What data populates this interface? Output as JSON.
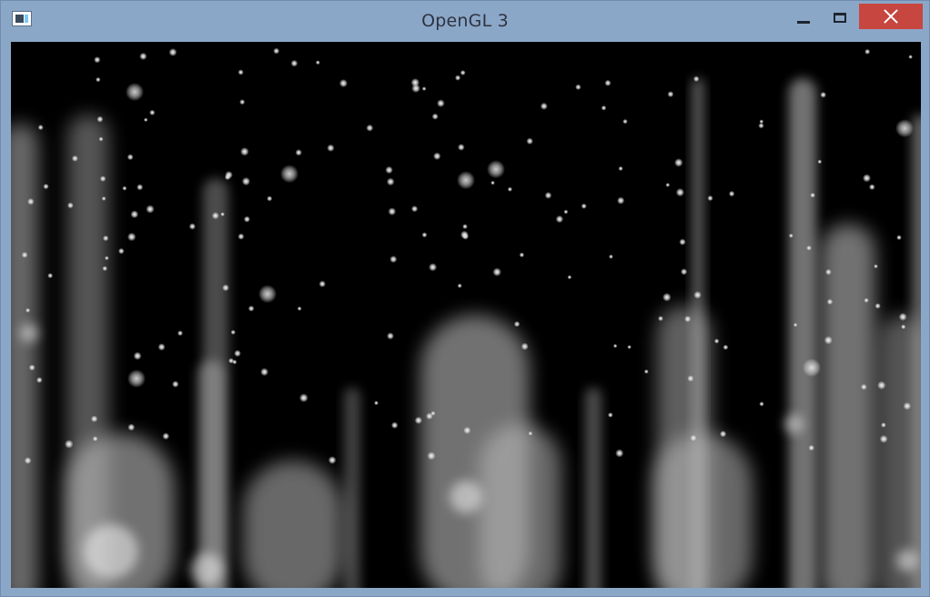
{
  "window": {
    "title": "OpenGL 3"
  },
  "controls": {
    "minimize_icon": "minimize-icon",
    "maximize_icon": "maximize-icon",
    "close_icon": "close-icon"
  },
  "colors": {
    "titlebar": "#8ba7c8",
    "close_button": "#c7463f",
    "canvas_background": "#000000",
    "particles": "#ffffff"
  }
}
